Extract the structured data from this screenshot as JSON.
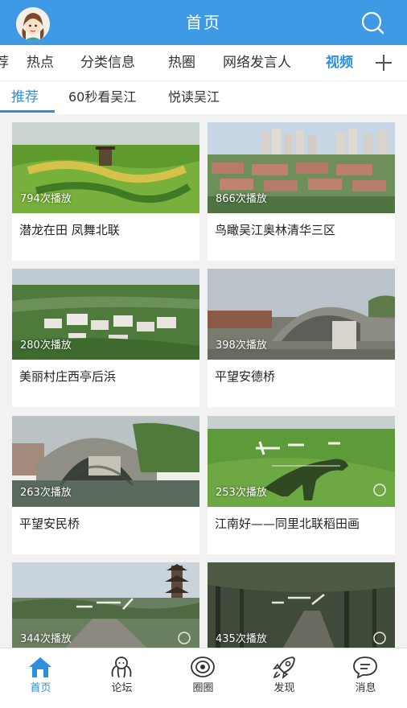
{
  "header": {
    "title": "首页"
  },
  "channels": [
    {
      "label": "荐",
      "active": false
    },
    {
      "label": "热点",
      "active": false
    },
    {
      "label": "分类信息",
      "active": false
    },
    {
      "label": "热圈",
      "active": false
    },
    {
      "label": "网络发言人",
      "active": false
    },
    {
      "label": "视频",
      "active": true
    }
  ],
  "sub_tabs": [
    {
      "label": "推荐",
      "active": true
    },
    {
      "label": "60秒看吴江",
      "active": false
    },
    {
      "label": "悦读吴江",
      "active": false
    }
  ],
  "videos": [
    {
      "plays": "794次播放",
      "title": "潜龙在田 凤舞北联"
    },
    {
      "plays": "866次播放",
      "title": "鸟瞰吴江奥林清华三区"
    },
    {
      "plays": "280次播放",
      "title": "美丽村庄西亭后浜"
    },
    {
      "plays": "398次播放",
      "title": "平望安德桥"
    },
    {
      "plays": "263次播放",
      "title": "平望安民桥"
    },
    {
      "plays": "253次播放",
      "title": "江南好——同里北联稻田画"
    },
    {
      "plays": "344次播放",
      "title": ""
    },
    {
      "plays": "435次播放",
      "title": ""
    }
  ],
  "bottom_nav": [
    {
      "label": "首页",
      "icon": "home-icon",
      "active": true
    },
    {
      "label": "论坛",
      "icon": "forum-icon",
      "active": false
    },
    {
      "label": "圈圈",
      "icon": "circle-icon",
      "active": false
    },
    {
      "label": "发现",
      "icon": "rocket-icon",
      "active": false
    },
    {
      "label": "消息",
      "icon": "message-icon",
      "active": false
    }
  ],
  "colors": {
    "header_bg": "#3f9ae6",
    "accent": "#2f8fdf"
  }
}
